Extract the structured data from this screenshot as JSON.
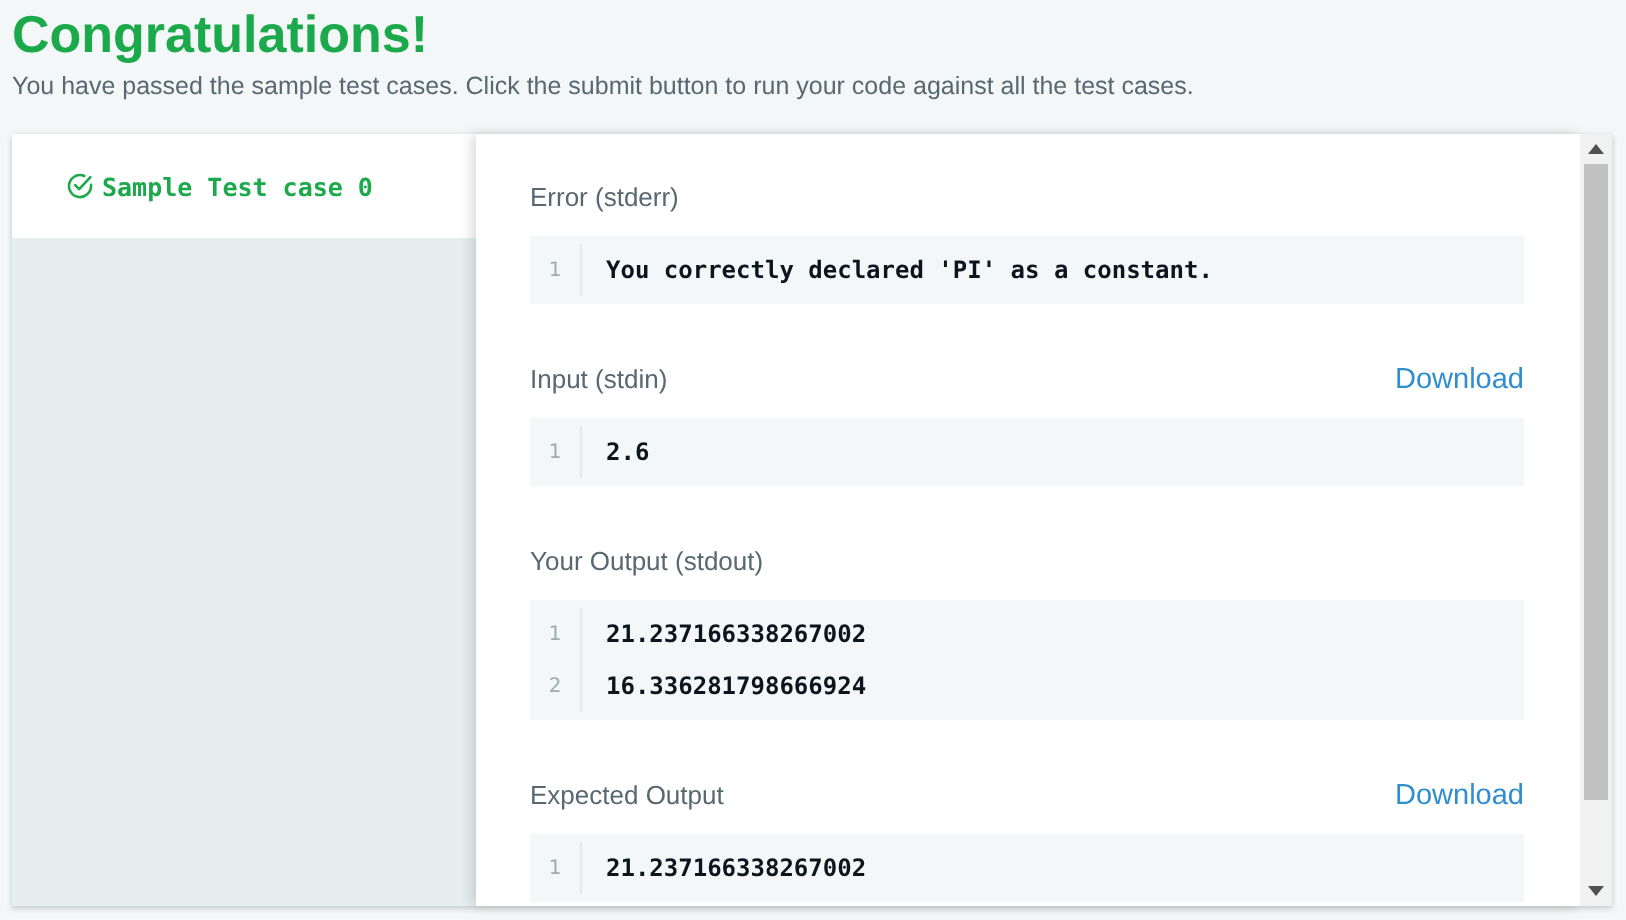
{
  "title": "Congratulations!",
  "subtitle": "You have passed the sample test cases. Click the submit button to run your code against all the test cases.",
  "test_cases": [
    {
      "label": "Sample Test case 0",
      "selected": true
    }
  ],
  "sections": [
    {
      "label": "Error (stderr)",
      "lines": [
        {
          "number": "1",
          "text": "You correctly declared 'PI' as a constant."
        }
      ]
    },
    {
      "label": "Input (stdin)",
      "download": "Download",
      "lines": [
        {
          "number": "1",
          "text": "2.6"
        }
      ]
    },
    {
      "label": "Your Output (stdout)",
      "lines": [
        {
          "number": "1",
          "text": "21.237166338267002"
        },
        {
          "number": "2",
          "text": "16.336281798666924"
        }
      ]
    },
    {
      "label": "Expected Output",
      "download": "Download",
      "lines": [
        {
          "number": "1",
          "text": "21.237166338267002"
        }
      ]
    }
  ]
}
